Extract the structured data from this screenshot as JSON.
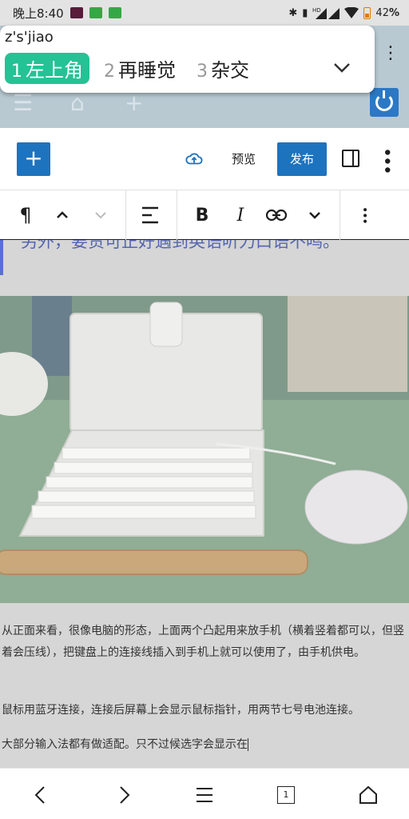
{
  "status_bar": {
    "time": "晚上8:40",
    "signal_info": "HD",
    "battery": "42",
    "battery_unit": "%"
  },
  "ime": {
    "pinyin": "z's'jiao",
    "candidates": [
      {
        "num": "1",
        "text": "左上角",
        "active": true
      },
      {
        "num": "2",
        "text": "再睡觉",
        "active": false
      },
      {
        "num": "3",
        "text": "杂交",
        "active": false
      }
    ]
  },
  "editor_toolbar": {
    "add_label": "+",
    "preview_label": "预览",
    "publish_label": "发布"
  },
  "block_toolbar": {
    "paragraph_glyph": "¶",
    "bold_label": "B",
    "italic_label": "I"
  },
  "content": {
    "quote_text": "另外，要责可正好遇到英语听力口语不鸣。",
    "paragraphs": [
      "从正面来看，很像电脑的形态，上面两个凸起用来放手机（横着竖着都可以，但竖着会压线），把键盘上的连接线插入到手机上就可以使用了，由手机供电。",
      "鼠标用蓝牙连接，连接后屏幕上会显示鼠标指针，用两节七号电池连接。",
      "大部分输入法都有做适配。只不过候选字会显示在"
    ]
  },
  "bottom_nav": {
    "tab_count": "1"
  },
  "colors": {
    "accent_blue": "#1e73be",
    "ime_green": "#24c295",
    "admin_bar": "#b8c9d2"
  }
}
